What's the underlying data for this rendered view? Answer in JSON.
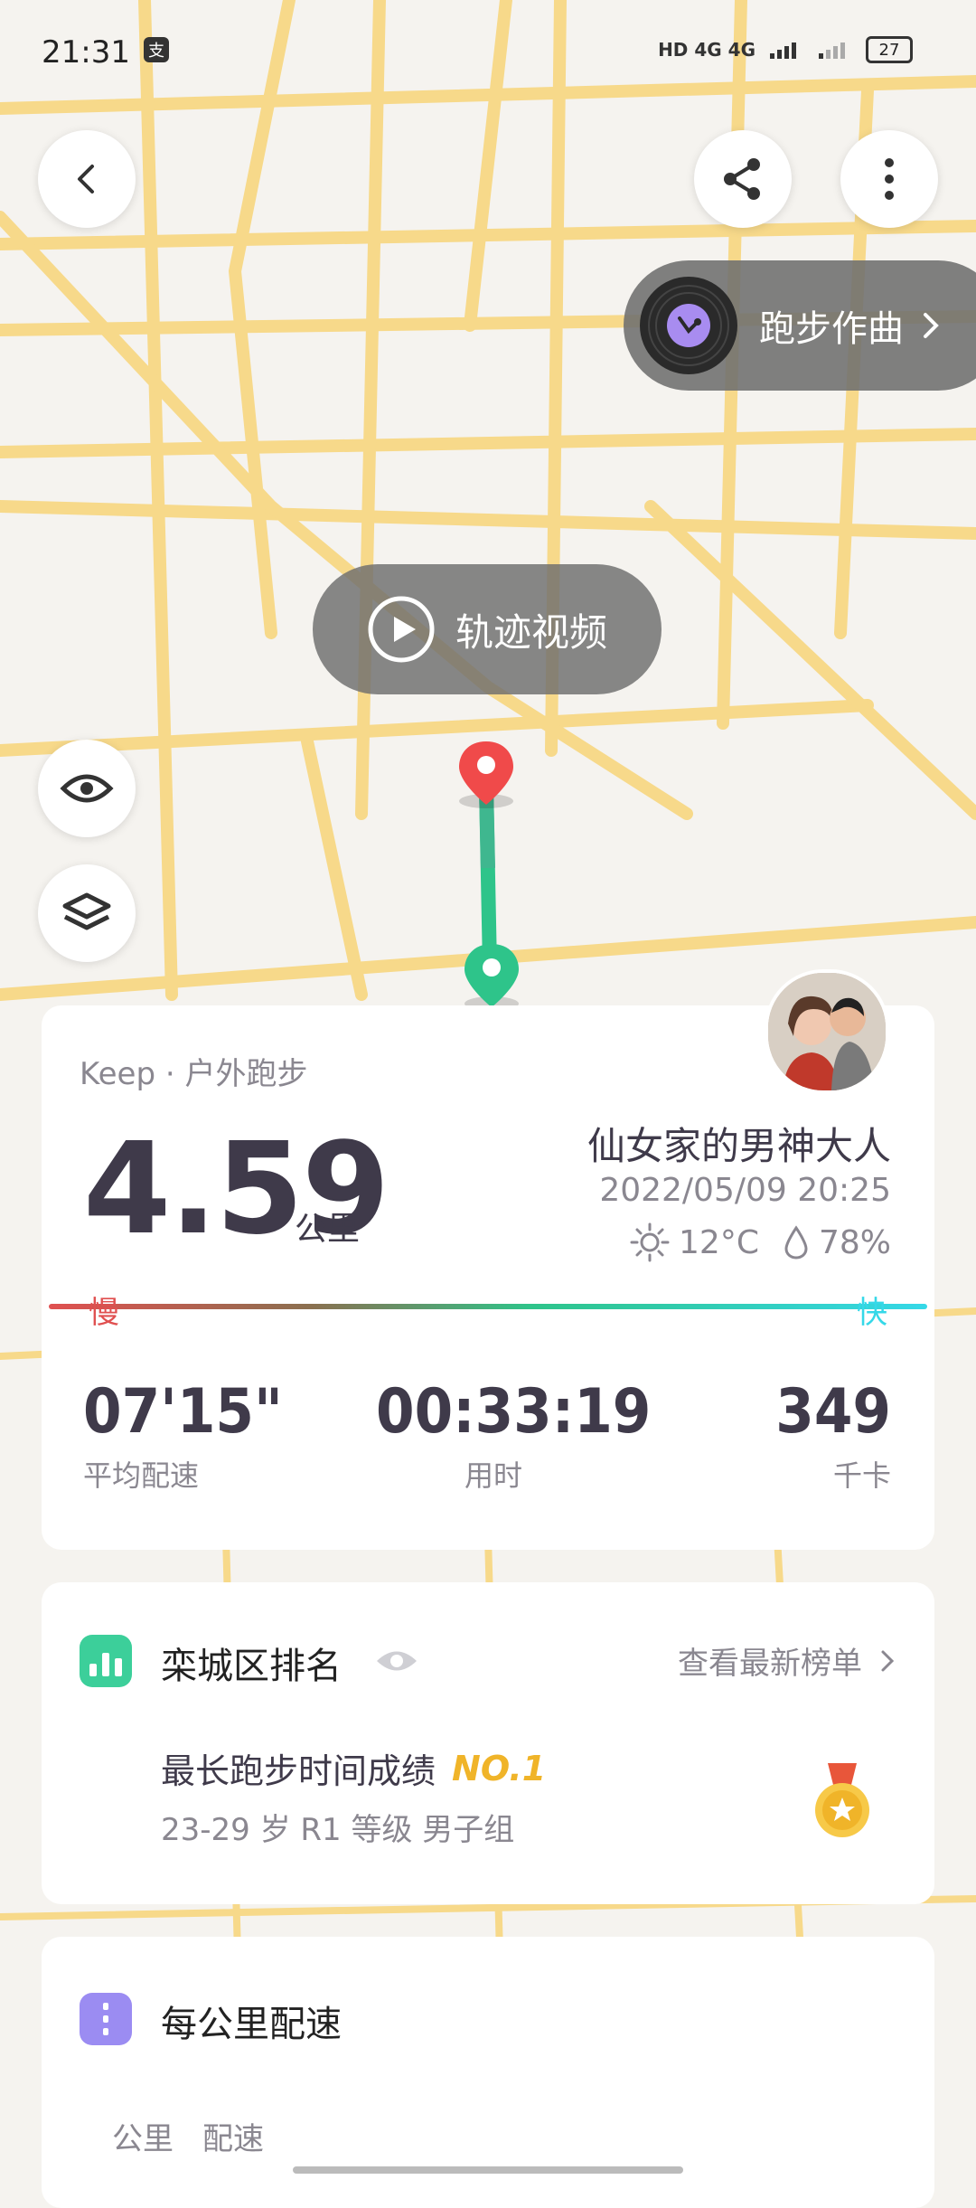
{
  "status_bar": {
    "time": "21:31",
    "app_icon": "alipay-icon",
    "network": "HD 4G 4G",
    "battery": "27"
  },
  "map": {
    "music_label": "跑步作曲",
    "video_label": "轨迹视频"
  },
  "summary": {
    "source": "Keep · 户外跑步",
    "distance_value": "4.59",
    "distance_unit": "公里",
    "user_name": "仙女家的男神大人",
    "datetime": "2022/05/09 20:25",
    "temperature": "12°C",
    "humidity": "78%",
    "slow_label": "慢",
    "fast_label": "快",
    "stats": [
      {
        "value": "07'15\"",
        "label": "平均配速"
      },
      {
        "value": "00:33:19",
        "label": "用时"
      },
      {
        "value": "349",
        "label": "千卡"
      }
    ]
  },
  "ranking": {
    "title": "栾城区排名",
    "view_latest": "查看最新榜单",
    "achievement": "最长跑步时间成绩",
    "rank_badge": "NO.1",
    "group": "23-29 岁 R1 等级 男子组"
  },
  "pace": {
    "title": "每公里配速",
    "col_km": "公里",
    "col_pace": "配速"
  },
  "colors": {
    "route_start": "#2ec48a",
    "route_end": "#f04a4a",
    "slow": "#e05050",
    "fast": "#35d8e8",
    "rank_gold": "#f0b429"
  }
}
